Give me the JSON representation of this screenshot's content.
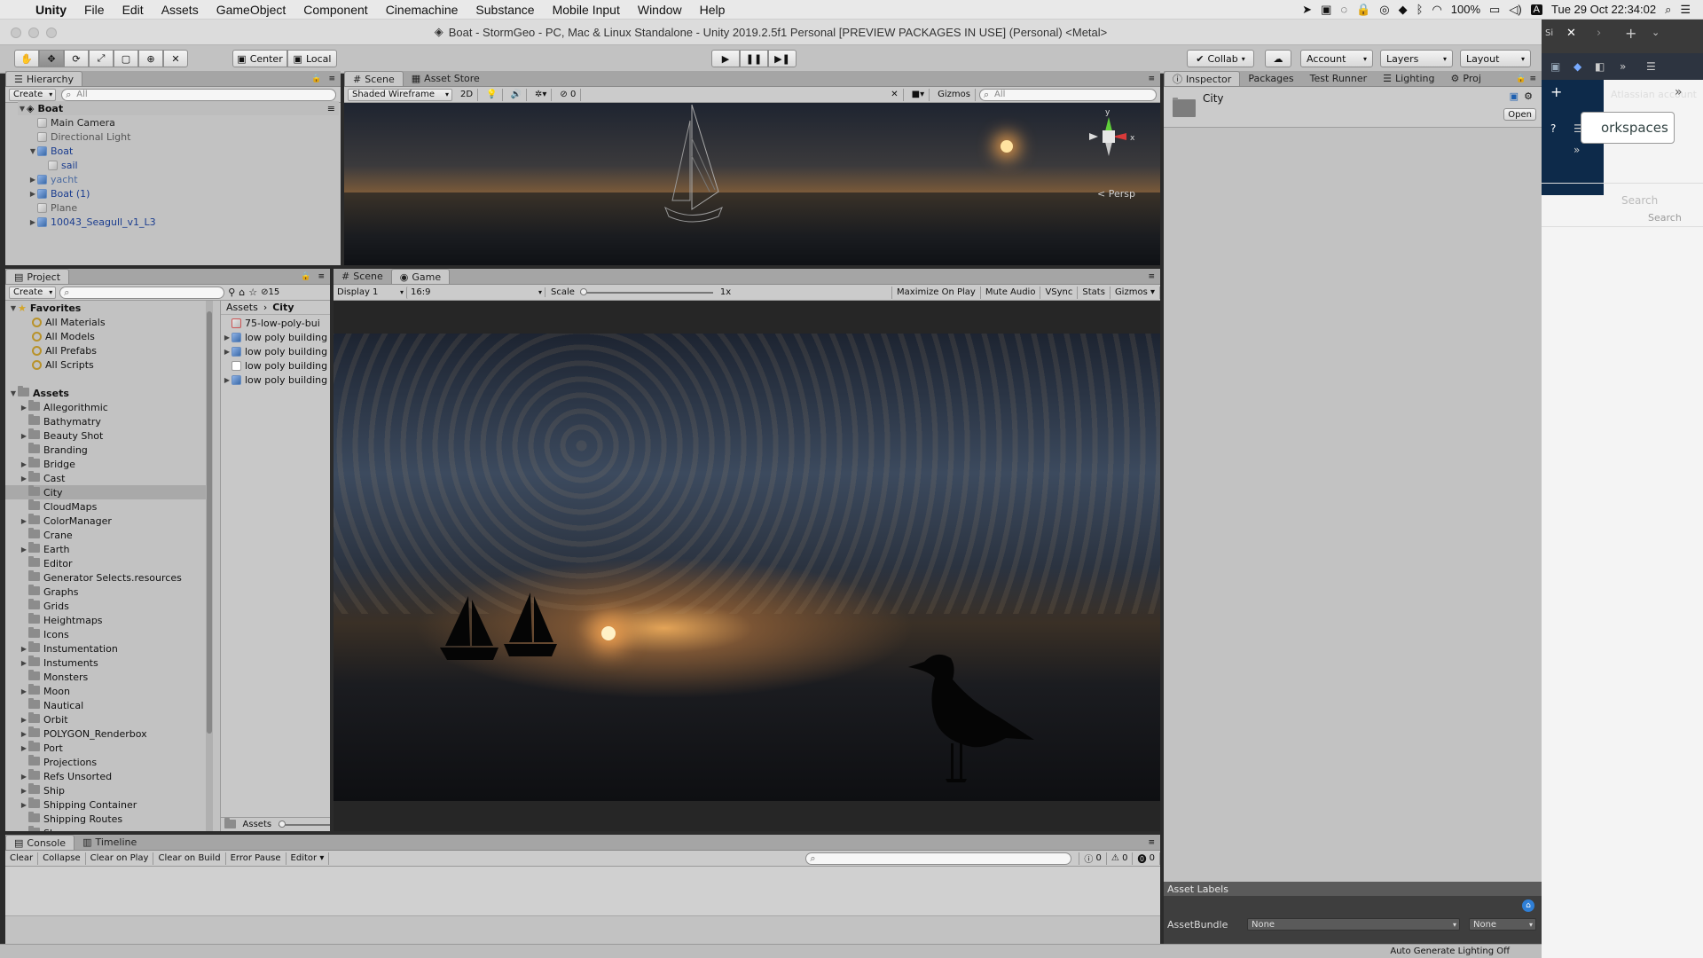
{
  "menubar": {
    "app": "Unity",
    "items": [
      "File",
      "Edit",
      "Assets",
      "GameObject",
      "Component",
      "Cinemachine",
      "Substance",
      "Mobile Input",
      "Window",
      "Help"
    ],
    "battery": "100%",
    "datetime": "Tue 29 Oct  22:34:02"
  },
  "window": {
    "title": "Boat - StormGeo - PC, Mac & Linux Standalone - Unity 2019.2.5f1 Personal [PREVIEW PACKAGES IN USE] (Personal) <Metal>"
  },
  "toolbar": {
    "center_label": "Center",
    "local_label": "Local",
    "collab_label": "Collab",
    "account_label": "Account",
    "layers_label": "Layers",
    "layout_label": "Layout"
  },
  "hierarchy": {
    "tab": "Hierarchy",
    "create": "Create",
    "search_placeholder": "All",
    "scene": "Boat",
    "items": [
      {
        "label": "Main Camera",
        "depth": 1,
        "expand": "",
        "color": "#222222",
        "icon": "grey"
      },
      {
        "label": "Directional Light",
        "depth": 1,
        "expand": "",
        "color": "#555555",
        "icon": "grey"
      },
      {
        "label": "Boat",
        "depth": 1,
        "expand": "▼",
        "color": "#1b3d8f",
        "icon": "blue"
      },
      {
        "label": "sail",
        "depth": 2,
        "expand": "",
        "color": "#1b3d8f",
        "icon": "grey"
      },
      {
        "label": "yacht",
        "depth": 1,
        "expand": "▶",
        "color": "#4a6aa0",
        "icon": "blue"
      },
      {
        "label": "Boat (1)",
        "depth": 1,
        "expand": "▶",
        "color": "#1b3d8f",
        "icon": "blue"
      },
      {
        "label": "Plane",
        "depth": 1,
        "expand": "",
        "color": "#555555",
        "icon": "grey"
      },
      {
        "label": "10043_Seagull_v1_L3",
        "depth": 1,
        "expand": "▶",
        "color": "#1b3d8f",
        "icon": "blue"
      }
    ]
  },
  "scene_view": {
    "tabs": [
      "Scene",
      "Asset Store"
    ],
    "shading": "Shaded Wireframe",
    "mode_2d": "2D",
    "fx_count": "0",
    "gizmos": "Gizmos",
    "search_placeholder": "All",
    "persp": "< Persp",
    "axis_y": "y",
    "axis_x": "x"
  },
  "inspector": {
    "tabs": [
      "Inspector",
      "Packages",
      "Test Runner",
      "Lighting",
      "Proj"
    ],
    "object_name": "City",
    "open_label": "Open",
    "asset_labels": "Asset Labels",
    "assetbundle_label": "AssetBundle",
    "assetbundle_value": "None",
    "variant_value": "None"
  },
  "project": {
    "tab": "Project",
    "create": "Create",
    "hidden_count": "15",
    "favorites_label": "Favorites",
    "favorites": [
      "All Materials",
      "All Models",
      "All Prefabs",
      "All Scripts"
    ],
    "assets_label": "Assets",
    "folders": [
      {
        "name": "Allegorithmic",
        "expand": "▶"
      },
      {
        "name": "Bathymatry",
        "expand": ""
      },
      {
        "name": "Beauty Shot",
        "expand": "▶"
      },
      {
        "name": "Branding",
        "expand": ""
      },
      {
        "name": "Bridge",
        "expand": "▶"
      },
      {
        "name": "Cast",
        "expand": "▶"
      },
      {
        "name": "City",
        "expand": ""
      },
      {
        "name": "CloudMaps",
        "expand": ""
      },
      {
        "name": "ColorManager",
        "expand": "▶"
      },
      {
        "name": "Crane",
        "expand": ""
      },
      {
        "name": "Earth",
        "expand": "▶"
      },
      {
        "name": "Editor",
        "expand": ""
      },
      {
        "name": "Generator Selects.resources",
        "expand": ""
      },
      {
        "name": "Graphs",
        "expand": ""
      },
      {
        "name": "Grids",
        "expand": ""
      },
      {
        "name": "Heightmaps",
        "expand": ""
      },
      {
        "name": "Icons",
        "expand": ""
      },
      {
        "name": "Instumentation",
        "expand": "▶"
      },
      {
        "name": "Instuments",
        "expand": "▶"
      },
      {
        "name": "Monsters",
        "expand": ""
      },
      {
        "name": "Moon",
        "expand": "▶"
      },
      {
        "name": "Nautical",
        "expand": ""
      },
      {
        "name": "Orbit",
        "expand": "▶"
      },
      {
        "name": "POLYGON_Renderbox",
        "expand": "▶"
      },
      {
        "name": "Port",
        "expand": "▶"
      },
      {
        "name": "Projections",
        "expand": ""
      },
      {
        "name": "Refs Unsorted",
        "expand": "▶"
      },
      {
        "name": "Ship",
        "expand": "▶"
      },
      {
        "name": "Shipping Container",
        "expand": "▶"
      },
      {
        "name": "Shipping Routes",
        "expand": ""
      },
      {
        "name": "Sky",
        "expand": ""
      }
    ],
    "selected_folder": "City",
    "breadcrumb": [
      "Assets",
      "City"
    ],
    "files": [
      {
        "name": "75-low-poly-bui",
        "expand": "",
        "kind": "doc"
      },
      {
        "name": "low poly building",
        "expand": "▶",
        "kind": "prefab"
      },
      {
        "name": "low poly building",
        "expand": "▶",
        "kind": "prefab"
      },
      {
        "name": "low poly building",
        "expand": "",
        "kind": "blank"
      },
      {
        "name": "low poly building",
        "expand": "▶",
        "kind": "prefab"
      }
    ],
    "footer": "Assets"
  },
  "game_view": {
    "tabs": [
      "Scene",
      "Game"
    ],
    "display": "Display 1",
    "aspect": "16:9",
    "scale_label": "Scale",
    "scale_value": "1x",
    "buttons": [
      "Maximize On Play",
      "Mute Audio",
      "VSync",
      "Stats",
      "Gizmos"
    ]
  },
  "console": {
    "tabs": [
      "Console",
      "Timeline"
    ],
    "buttons": [
      "Clear",
      "Collapse",
      "Clear on Play",
      "Clear on Build",
      "Error Pause",
      "Editor"
    ],
    "info_count": "0",
    "warn_count": "0",
    "error_count": "0"
  },
  "statusbar": {
    "text": "Auto Generate Lighting Off"
  },
  "side_browser": {
    "workspaces": "orkspaces",
    "atlassian": "Atlassian account",
    "search_placeholder": "Search",
    "search_caption": "Search"
  }
}
